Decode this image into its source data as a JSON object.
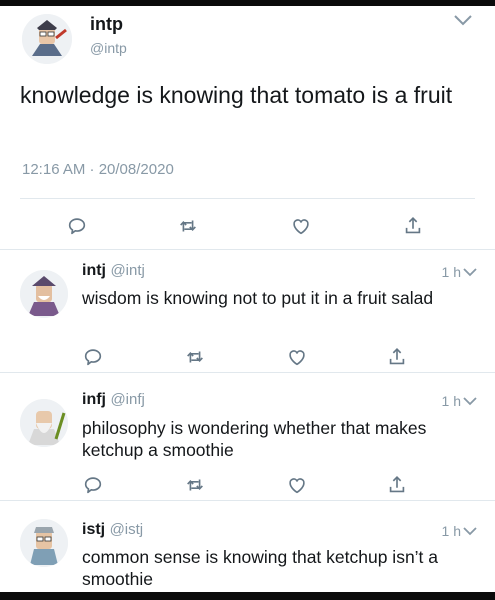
{
  "main_tweet": {
    "name": "intp",
    "handle": "@intp",
    "text": "knowledge is knowing that tomato is a fruit",
    "timestamp": "12:16 AM · 20/08/2020"
  },
  "replies": [
    {
      "name": "intj",
      "handle": "@intj",
      "time": "1 h",
      "text": "wisdom is knowing not to put it in a fruit salad"
    },
    {
      "name": "infj",
      "handle": "@infj",
      "time": "1 h",
      "text": "philosophy is wondering whether that makes ketchup a smoothie"
    },
    {
      "name": "istj",
      "handle": "@istj",
      "time": "1 h",
      "text": "common sense is knowing that ketchup isn’t a smoothie"
    }
  ],
  "icons": [
    "reply-icon",
    "retweet-icon",
    "like-icon",
    "share-icon",
    "chevron-down-icon"
  ],
  "colors": {
    "muted": "#8899a6",
    "text": "#14171a",
    "divider": "#e1e8ed"
  }
}
